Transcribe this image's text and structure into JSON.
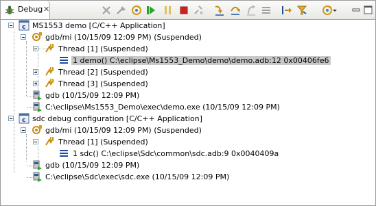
{
  "tab": {
    "label": "Debug",
    "close": "✕"
  },
  "toolbar": [
    "remove-terminated-icon",
    "connect-icon",
    "relaunch-icon",
    "resume-icon",
    "suspend-icon",
    "terminate-icon",
    "disconnect-icon",
    "step-into-icon",
    "step-over-icon",
    "step-return-icon",
    "drop-to-frame-icon",
    "instruction-stepping-icon",
    "use-step-filters-icon",
    "view-menu-icon",
    "view-menu-chevron-icon"
  ],
  "tree": {
    "launch1": "MS1553 demo [C/C++ Application]",
    "target1": "gdb/mi (10/15/09 12:09 PM) (Suspended)",
    "thread1_1": "Thread [1] (Suspended)",
    "frame1": "1 demo() C:\\eclipse\\Ms1553_Demo\\demo\\demo.adb:12 0x00406fe6",
    "thread1_2": "Thread [2] (Suspended)",
    "thread1_3": "Thread [3] (Suspended)",
    "gdb1": "gdb (10/15/09 12:09 PM)",
    "proc1": "C:\\eclipse\\Ms1553_Demo\\exec\\demo.exe (10/15/09 12:09 PM)",
    "launch2": "sdc debug configuration [C/C++ Application]",
    "target2": "gdb/mi (10/15/09 12:09 PM) (Suspended)",
    "thread2_1": "Thread [1] (Suspended)",
    "frame2": "1 sdc() C:\\eclipse\\Sdc\\common\\sdc.adb:9 0x0040409a",
    "gdb2": "gdb (10/15/09 12:09 PM)",
    "proc2": "C:\\eclipse\\Sdc\\exec\\sdc.exe (10/15/09 12:09 PM)"
  },
  "colors": {
    "selection": "#c8c8c8",
    "resume_green": "#2aa52a",
    "terminate_red": "#d02020"
  }
}
